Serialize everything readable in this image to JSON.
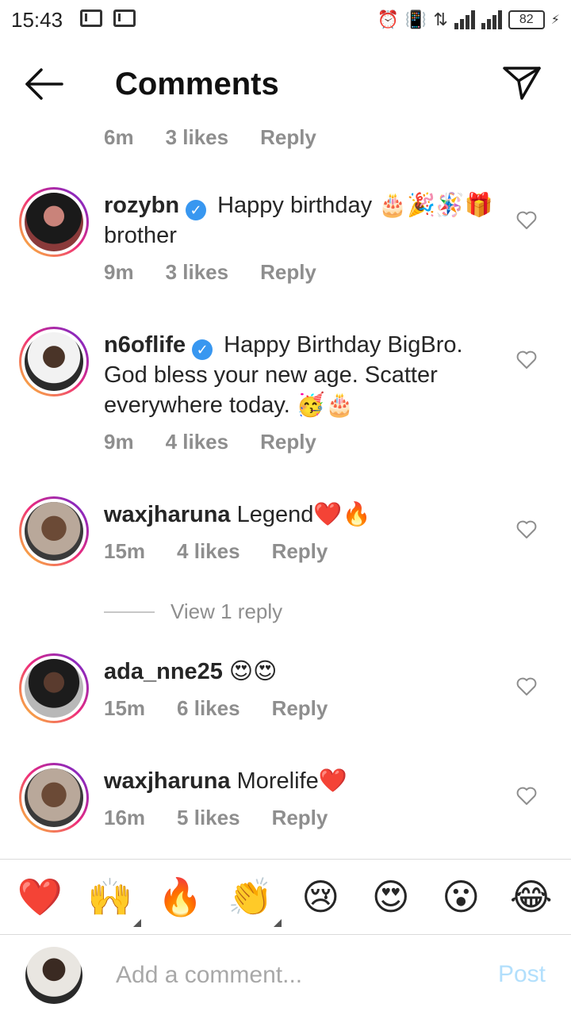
{
  "status_bar": {
    "time": "15:43",
    "battery": "82"
  },
  "header": {
    "title": "Comments"
  },
  "top_meta": {
    "time": "6m",
    "likes": "3 likes",
    "reply": "Reply"
  },
  "comments": [
    {
      "username": "rozybn",
      "verified": true,
      "text": "Happy birthday 🎂🎉🪅🎁 brother",
      "time": "9m",
      "likes": "3 likes",
      "reply": "Reply"
    },
    {
      "username": "n6oflife",
      "verified": true,
      "text": "Happy Birthday BigBro. God bless your new age. Scatter everywhere today. 🥳🎂",
      "time": "9m",
      "likes": "4 likes",
      "reply": "Reply"
    },
    {
      "username": "waxjharuna",
      "verified": false,
      "text": "Legend❤️🔥",
      "time": "15m",
      "likes": "4 likes",
      "reply": "Reply"
    },
    {
      "username": "ada_nne25",
      "verified": false,
      "text": "😍😍",
      "time": "15m",
      "likes": "6 likes",
      "reply": "Reply"
    },
    {
      "username": "waxjharuna",
      "verified": false,
      "text": "Morelife❤️",
      "time": "16m",
      "likes": "5 likes",
      "reply": "Reply"
    }
  ],
  "view_replies": "View 1 reply",
  "emoji_bar": [
    "❤️",
    "🙌",
    "🔥",
    "👏",
    "😢",
    "😍",
    "😮",
    "😂"
  ],
  "composer": {
    "placeholder": "Add a comment...",
    "post_label": "Post"
  }
}
